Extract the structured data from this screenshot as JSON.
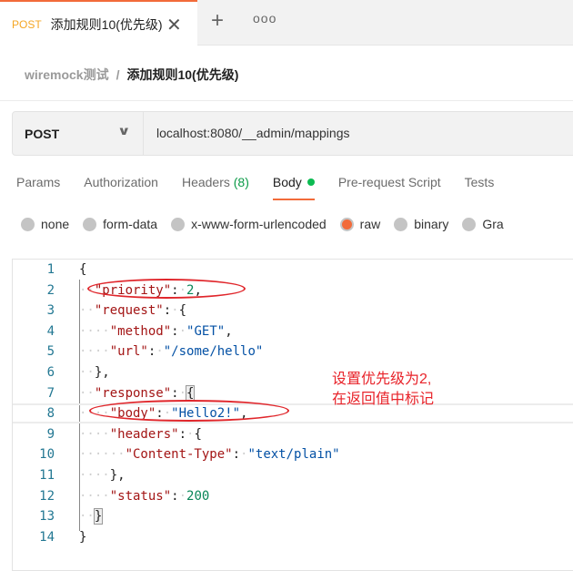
{
  "tab": {
    "method": "POST",
    "title": "添加规则10(优先级)",
    "close_icon": "close-icon",
    "new_tab_icon": "plus-icon",
    "more_icon": "ellipsis-icon",
    "accent": "#f26b3a"
  },
  "breadcrumb": {
    "collection": "wiremock测试",
    "separator": "/",
    "request": "添加规则10(优先级)"
  },
  "request": {
    "method": "POST",
    "url": "localhost:8080/__admin/mappings"
  },
  "request_tabs": [
    {
      "label": "Params"
    },
    {
      "label": "Authorization"
    },
    {
      "label": "Headers",
      "count": "(8)"
    },
    {
      "label": "Body",
      "active": true
    },
    {
      "label": "Pre-request Script"
    },
    {
      "label": "Tests"
    }
  ],
  "body_types": [
    {
      "label": "none"
    },
    {
      "label": "form-data"
    },
    {
      "label": "x-www-form-urlencoded"
    },
    {
      "label": "raw",
      "selected": true
    },
    {
      "label": "binary"
    },
    {
      "label": "Gra"
    }
  ],
  "editor": {
    "lines": [
      [
        [
          "p",
          "{"
        ]
      ],
      [
        [
          "ws",
          "··"
        ],
        [
          "k",
          "\"priority\""
        ],
        [
          "p",
          ":"
        ],
        [
          "ws",
          "·"
        ],
        [
          "n",
          "2"
        ],
        [
          "p",
          ","
        ]
      ],
      [
        [
          "ws",
          "··"
        ],
        [
          "k",
          "\"request\""
        ],
        [
          "p",
          ":"
        ],
        [
          "ws",
          "·"
        ],
        [
          "p",
          "{"
        ]
      ],
      [
        [
          "ws",
          "····"
        ],
        [
          "k",
          "\"method\""
        ],
        [
          "p",
          ":"
        ],
        [
          "ws",
          "·"
        ],
        [
          "s",
          "\"GET\""
        ],
        [
          "p",
          ","
        ]
      ],
      [
        [
          "ws",
          "····"
        ],
        [
          "k",
          "\"url\""
        ],
        [
          "p",
          ":"
        ],
        [
          "ws",
          "·"
        ],
        [
          "s",
          "\"/some/hello\""
        ]
      ],
      [
        [
          "ws",
          "··"
        ],
        [
          "p",
          "},"
        ]
      ],
      [
        [
          "ws",
          "··"
        ],
        [
          "k",
          "\"response\""
        ],
        [
          "p",
          ":"
        ],
        [
          "ws",
          "·"
        ],
        [
          "p",
          "{"
        ]
      ],
      [
        [
          "ws",
          "····"
        ],
        [
          "k",
          "\"body\""
        ],
        [
          "p",
          ":"
        ],
        [
          "ws",
          "·"
        ],
        [
          "s",
          "\"Hello2!\""
        ],
        [
          "p",
          ","
        ]
      ],
      [
        [
          "ws",
          "····"
        ],
        [
          "k",
          "\"headers\""
        ],
        [
          "p",
          ":"
        ],
        [
          "ws",
          "·"
        ],
        [
          "p",
          "{"
        ]
      ],
      [
        [
          "ws",
          "······"
        ],
        [
          "k",
          "\"Content-Type\""
        ],
        [
          "p",
          ":"
        ],
        [
          "ws",
          "·"
        ],
        [
          "s",
          "\"text/plain\""
        ]
      ],
      [
        [
          "ws",
          "····"
        ],
        [
          "p",
          "},"
        ]
      ],
      [
        [
          "ws",
          "····"
        ],
        [
          "k",
          "\"status\""
        ],
        [
          "p",
          ":"
        ],
        [
          "ws",
          "·"
        ],
        [
          "n",
          "200"
        ]
      ],
      [
        [
          "ws",
          "··"
        ],
        [
          "p",
          "}"
        ]
      ],
      [
        [
          "p",
          "}"
        ]
      ]
    ]
  },
  "annotation": {
    "line1": "设置优先级为2,",
    "line2": "在返回值中标记"
  }
}
